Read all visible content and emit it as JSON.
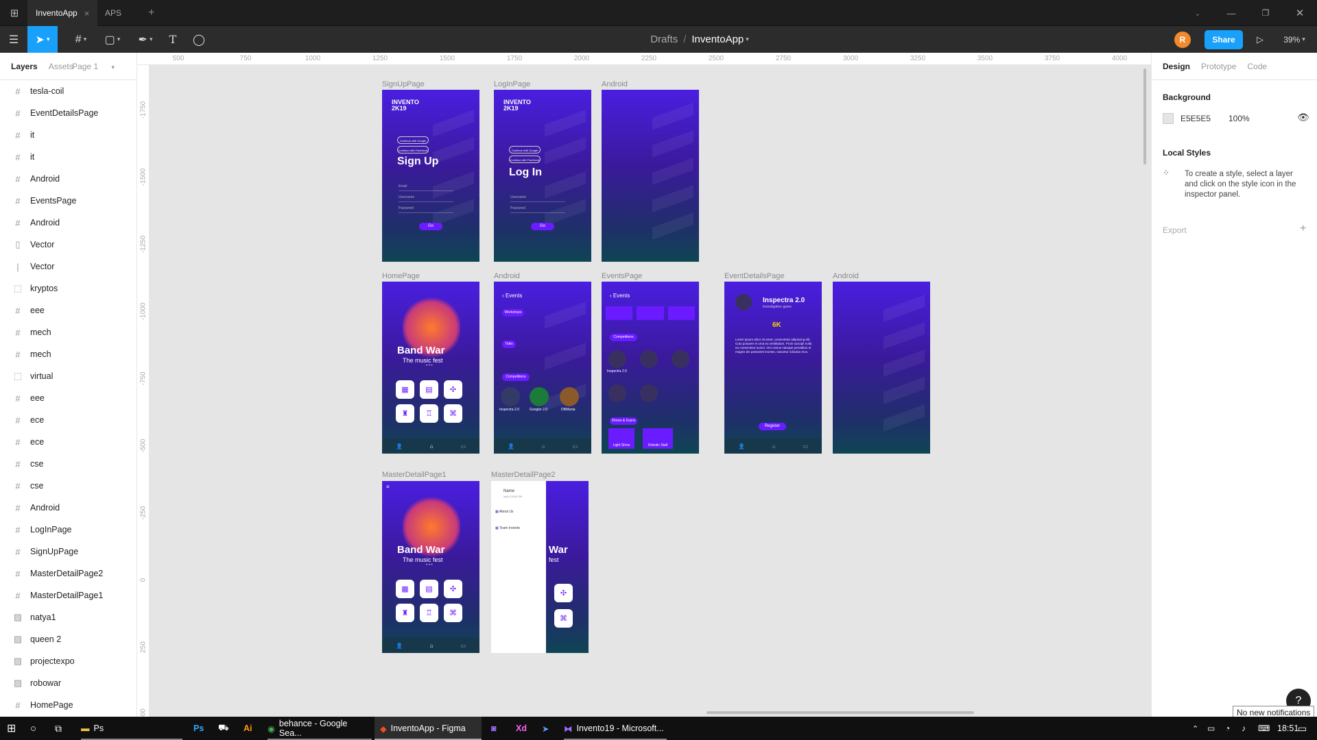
{
  "tabs": [
    {
      "label": "InventoApp",
      "close": "×"
    },
    {
      "label": "APS"
    }
  ],
  "tab_add": "+",
  "toolbar": {
    "breadcrumb_parent": "Drafts",
    "breadcrumb_sep": "/",
    "file_name": "InventoApp",
    "avatar_initial": "R",
    "share_label": "Share",
    "zoom": "39%"
  },
  "left_panel": {
    "tabs": [
      "Layers",
      "Assets"
    ],
    "page": "Page 1",
    "layers": [
      {
        "icon": "#",
        "label": "tesla-coil"
      },
      {
        "icon": "#",
        "label": "EventDetailsPage"
      },
      {
        "icon": "#",
        "label": "it"
      },
      {
        "icon": "#",
        "label": "it"
      },
      {
        "icon": "#",
        "label": "Android"
      },
      {
        "icon": "#",
        "label": "EventsPage"
      },
      {
        "icon": "#",
        "label": "Android"
      },
      {
        "icon": "▯",
        "label": "Vector"
      },
      {
        "icon": "|",
        "label": "Vector"
      },
      {
        "icon": "⬚",
        "label": "kryptos"
      },
      {
        "icon": "#",
        "label": "eee"
      },
      {
        "icon": "#",
        "label": "mech"
      },
      {
        "icon": "#",
        "label": "mech"
      },
      {
        "icon": "⬚",
        "label": "virtual"
      },
      {
        "icon": "#",
        "label": "eee"
      },
      {
        "icon": "#",
        "label": "ece"
      },
      {
        "icon": "#",
        "label": "ece"
      },
      {
        "icon": "#",
        "label": "cse"
      },
      {
        "icon": "#",
        "label": "cse"
      },
      {
        "icon": "#",
        "label": "Android"
      },
      {
        "icon": "#",
        "label": "LogInPage"
      },
      {
        "icon": "#",
        "label": "SignUpPage"
      },
      {
        "icon": "#",
        "label": "MasterDetailPage2"
      },
      {
        "icon": "#",
        "label": "MasterDetailPage1"
      },
      {
        "icon": "▨",
        "label": "natya1"
      },
      {
        "icon": "▨",
        "label": "queen 2"
      },
      {
        "icon": "▨",
        "label": "projectexpo"
      },
      {
        "icon": "▨",
        "label": "robowar"
      },
      {
        "icon": "#",
        "label": "HomePage"
      }
    ]
  },
  "right_panel": {
    "tabs": [
      "Design",
      "Prototype",
      "Code"
    ],
    "background_title": "Background",
    "bg_hex": "E5E5E5",
    "bg_opacity": "100%",
    "local_styles_title": "Local Styles",
    "local_styles_hint": "To create a style, select a layer and click on the style icon in the inspector panel.",
    "export_title": "Export",
    "export_add": "+"
  },
  "rulers": {
    "h": [
      "500",
      "750",
      "1000",
      "1250",
      "1500",
      "1750",
      "2000",
      "2250",
      "2500",
      "2750",
      "3000",
      "3250",
      "3500",
      "3750",
      "4000"
    ],
    "v": [
      "-1750",
      "-1500",
      "-1250",
      "-1000",
      "-750",
      "-500",
      "-250",
      "0",
      "250",
      "500"
    ]
  },
  "frames": {
    "signup": {
      "label": "SignUpPage",
      "title": "Sign Up",
      "logo1": "INVENTO",
      "logo2": "2K19",
      "btn": "Go",
      "f1": "Email",
      "f2": "Username",
      "f3": "Password",
      "g1": "Continue with Google",
      "g2": "Continue with Facebook"
    },
    "login": {
      "label": "LogInPage",
      "title": "Log In",
      "logo1": "INVENTO",
      "logo2": "2K19",
      "btn": "Go",
      "f1": "Username",
      "f2": "Password",
      "g1": "Continue with Google",
      "g2": "Continue with Facebook"
    },
    "android1": {
      "label": "Android"
    },
    "home": {
      "label": "HomePage",
      "title": "Band War",
      "subtitle": "The music fest",
      "dots": "• • •"
    },
    "android2": {
      "label": "Android",
      "header": "‹ Events",
      "c1": "Workshops",
      "c2": "Talks",
      "c3": "Competitions",
      "i1": "Inspectra 2.0",
      "i2": "Googler 2.0",
      "i3": "DBMania"
    },
    "events": {
      "label": "EventsPage",
      "header": "‹ Events",
      "c1": "Competitions",
      "c2": "Shows & Expos",
      "s1": "Light Show",
      "s2": "Robotic Stall",
      "i1": "Inspectra 2.0"
    },
    "details": {
      "label": "EventDetailsPage",
      "title": "Inspectra 2.0",
      "subtitle": "Investigation game",
      "prize": "6K",
      "btn": "Register",
      "body": "Lorem ipsum dolor sit amet, consectetur adipiscing elit. Cras posuere et urna eu vestibulum. Proin suscipit nulla eu consectetur auctor. Orci varius natoque penatibus et magnis dis parturient montes, nascetur ridiculus mus."
    },
    "android3": {
      "label": "Android"
    },
    "master1": {
      "label": "MasterDetailPage1",
      "title": "Band War",
      "subtitle": "The music fest",
      "dots": "• • •"
    },
    "master2": {
      "label": "MasterDetailPage2",
      "name": "Name",
      "email": "id@123456789",
      "m1": "About Us",
      "m2": "Team Invento",
      "title_frag": "War",
      "sub_frag": "fest"
    }
  },
  "notification": "No new notifications",
  "taskbar": {
    "items": [
      {
        "label": "Ps"
      },
      {
        "label": "behance - Google Sea..."
      },
      {
        "label": "InventoApp - Figma"
      },
      {
        "label": "Invento19 - Microsoft..."
      }
    ],
    "clock": "18:51"
  },
  "colors": {
    "accent": "#18a0fb",
    "frame_top": "#4a1ee0",
    "frame_bottom": "#0e4553",
    "purple": "#6a1bff"
  }
}
